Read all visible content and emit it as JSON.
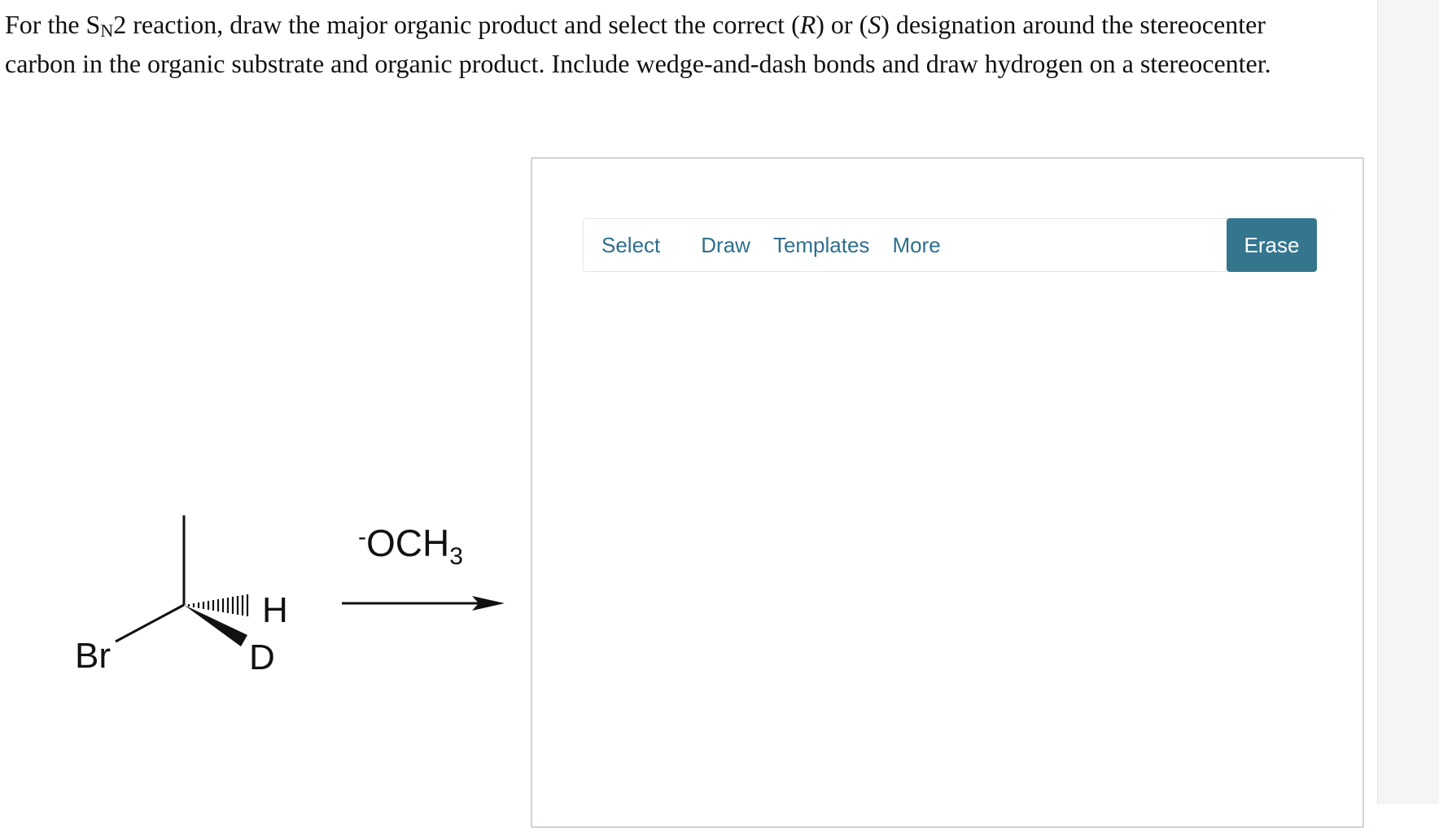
{
  "question": {
    "part1": "For the S",
    "subscript": "N",
    "part2": "2 reaction, draw the major organic product and select the correct (",
    "r_label": "R",
    "part3": ") or (",
    "s_label": "S",
    "part4": ") designation around the stereocenter carbon in the organic substrate and organic product. Include wedge-and-dash bonds and draw hydrogen on a stereocenter."
  },
  "reaction": {
    "substrate_labels": {
      "leaving_group": "Br",
      "hydrogen": "H",
      "deuterium": "D"
    },
    "reagent": {
      "charge": "-",
      "formula_main": "OCH",
      "formula_sub": "3"
    }
  },
  "editor": {
    "tabs": {
      "select": "Select",
      "draw": "Draw",
      "templates": "Templates",
      "more": "More"
    },
    "erase_label": "Erase",
    "accent_color": "#35768f",
    "tab_text_color": "#2f6f8c"
  }
}
